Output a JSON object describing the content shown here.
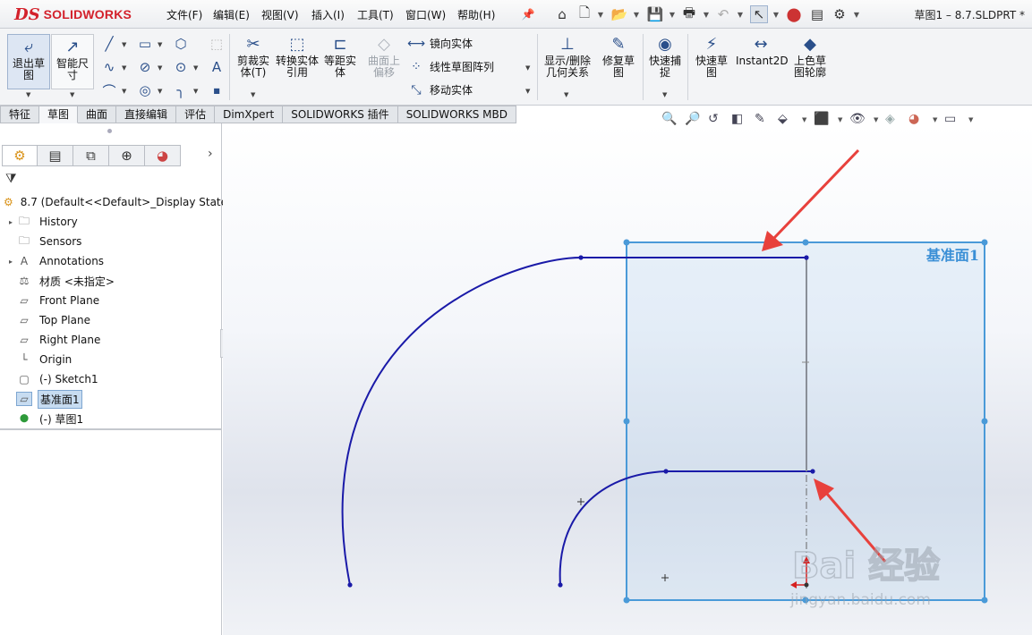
{
  "app": {
    "logo_prefix": "DS",
    "logo_text": "SOLIDWORKS",
    "document_title": "草图1 – 8.7.SLDPRT *"
  },
  "menu": [
    "文件(F)",
    "编辑(E)",
    "视图(V)",
    "插入(I)",
    "工具(T)",
    "窗口(W)",
    "帮助(H)"
  ],
  "command_manager": {
    "exit_sketch": "退出草图",
    "smart_dimension": "智能尺寸",
    "trim_entities": "剪裁实体(T)",
    "convert_entities": "转换实体引用",
    "offset_entities": "等距实体",
    "offset_on_surface": "曲面上偏移",
    "mirror_entities": "镜向实体",
    "linear_pattern": "线性草图阵列",
    "move_entities": "移动实体",
    "display_delete_relations": "显示/删除几何关系",
    "repair_sketch": "修复草图",
    "quick_snaps": "快速捕捉",
    "rapid_sketch": "快速草图",
    "instant2d": "Instant2D",
    "shaded_sketch_contours": "上色草图轮廓"
  },
  "tabs": [
    {
      "label": "特征",
      "active": false
    },
    {
      "label": "草图",
      "active": true
    },
    {
      "label": "曲面",
      "active": false
    },
    {
      "label": "直接编辑",
      "active": false
    },
    {
      "label": "评估",
      "active": false
    },
    {
      "label": "DimXpert",
      "active": false
    },
    {
      "label": "SOLIDWORKS 插件",
      "active": false
    },
    {
      "label": "SOLIDWORKS MBD",
      "active": false
    }
  ],
  "feature_tree": {
    "root": "8.7  (Default<<Default>_Display State",
    "items": [
      {
        "label": "History",
        "icon": "history-folder-icon",
        "expandable": true
      },
      {
        "label": "Sensors",
        "icon": "sensors-folder-icon",
        "expandable": false
      },
      {
        "label": "Annotations",
        "icon": "annotations-icon",
        "expandable": true
      },
      {
        "label": "材质 <未指定>",
        "icon": "material-icon",
        "expandable": false
      },
      {
        "label": "Front Plane",
        "icon": "plane-icon",
        "expandable": false
      },
      {
        "label": "Top Plane",
        "icon": "plane-icon",
        "expandable": false
      },
      {
        "label": "Right Plane",
        "icon": "plane-icon",
        "expandable": false
      },
      {
        "label": "Origin",
        "icon": "origin-icon",
        "expandable": false
      },
      {
        "label": "(-) Sketch1",
        "icon": "sketch-icon",
        "expandable": false
      },
      {
        "label": "基准面1",
        "icon": "plane-icon",
        "expandable": false,
        "selected": true
      },
      {
        "label": "(-) 草图1",
        "icon": "sketch-edit-icon",
        "expandable": false
      }
    ]
  },
  "graphics": {
    "plane_label": "基准面1",
    "watermark_text": "Bai 经验",
    "watermark_url": "jingyan.baidu.com"
  },
  "colors": {
    "sketch_line": "#1a1aa8",
    "plane_border": "#4a9ad8",
    "plane_label": "#3a8fd6",
    "arrow": "#e8413c",
    "logo": "#d3212b"
  }
}
